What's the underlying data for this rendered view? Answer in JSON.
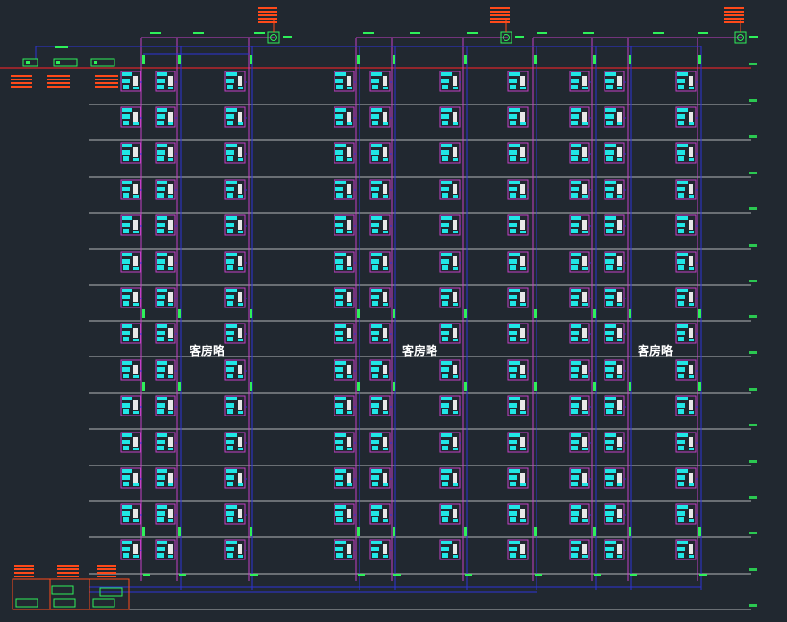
{
  "drawing": {
    "background": "#212830",
    "colors": {
      "floor_line": "#e6e6e6",
      "roof_line": "#d8262b",
      "riser": "#c43fc6",
      "main_pipe": "#2d33d6",
      "equipment_red": "#ff4a1a",
      "equipment_green": "#2ef05a",
      "device_cyan": "#20e6e6",
      "device_frame": "#c43fc6",
      "tag_green": "#2ef05a",
      "label_white": "#ffffff"
    },
    "zone_labels": [
      "客房略",
      "客房略",
      "客房略"
    ],
    "floor_count": 14,
    "column_groups": 3
  }
}
